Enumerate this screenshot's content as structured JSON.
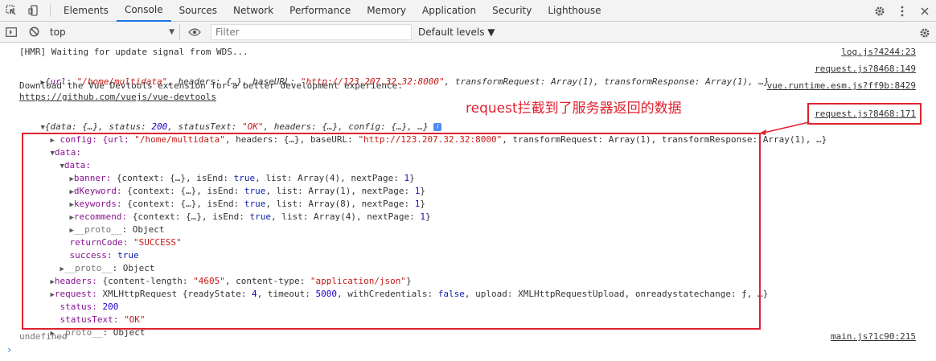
{
  "tabs": [
    "Elements",
    "Console",
    "Sources",
    "Network",
    "Performance",
    "Memory",
    "Application",
    "Security",
    "Lighthouse"
  ],
  "active_tab": "Console",
  "toolbar": {
    "context": "top",
    "filter_placeholder": "Filter",
    "levels": "Default levels ▼"
  },
  "messages": {
    "hmr": "[HMR] Waiting for update signal from WDS...",
    "hmr_src": "log.js?4244:23",
    "req1_key_url": "url",
    "req1_val_url": "\"/home/multidata\"",
    "req1_rest1": ", headers: {…}, baseURL: ",
    "req1_val_base": "\"http://123.207.32.32:8000\"",
    "req1_rest2": ", transformRequest: Array(1), transformResponse: Array(1), …}",
    "req1_src": "request.js?8468:149",
    "devtools_line1": "Download the Vue Devtools extension for a better development experience:",
    "devtools_link": "https://github.com/vuejs/vue-devtools",
    "devtools_src": "vue.runtime.esm.js?ff9b:8429",
    "resp_summary_pre": "{data: {…}, status: ",
    "resp_status": "200",
    "resp_summary_mid": ", statusText: ",
    "resp_statustext": "\"OK\"",
    "resp_summary_post": ", headers: {…}, config: {…}, …}",
    "resp_src": "request.js?8468:171",
    "config_line_pre": "config: {url: ",
    "config_url": "\"/home/multidata\"",
    "config_mid": ", headers: {…}, baseURL: ",
    "config_base": "\"http://123.207.32.32:8000\"",
    "config_post": ", transformRequest: Array(1), transformResponse: Array(1), …}",
    "data_key": "data:",
    "data_inner_key": "data:",
    "banner": "banner: ",
    "banner_val_pre": "{context: {…}, isEnd: ",
    "banner_true": "true",
    "banner_val_mid": ", list: Array(4), nextPage: ",
    "banner_num": "1",
    "banner_close": "}",
    "dkeyword": "dKeyword: ",
    "dkeyword_val_pre": "{context: {…}, isEnd: ",
    "dkeyword_true": "true",
    "dkeyword_val_mid": ", list: Array(1), nextPage: ",
    "dkeyword_num": "1",
    "dkeyword_close": "}",
    "keywords": "keywords: ",
    "keywords_val_pre": "{context: {…}, isEnd: ",
    "keywords_true": "true",
    "keywords_val_mid": ", list: Array(8), nextPage: ",
    "keywords_num": "1",
    "keywords_close": "}",
    "recommend": "recommend: ",
    "recommend_val_pre": "{context: {…}, isEnd: ",
    "recommend_true": "true",
    "recommend_val_mid": ", list: Array(4), nextPage: ",
    "recommend_num": "1",
    "recommend_close": "}",
    "proto1": "__proto__",
    "proto1_val": ": Object",
    "return_code_key": "returnCode: ",
    "return_code_val": "\"SUCCESS\"",
    "success_key": "success: ",
    "success_val": "true",
    "proto2": "__proto__",
    "proto2_val": ": Object",
    "headers_key": "headers: ",
    "headers_pre": "{content-length: ",
    "headers_len": "\"4605\"",
    "headers_mid": ", content-type: ",
    "headers_type": "\"application/json\"",
    "headers_close": "}",
    "request_key": "request: ",
    "request_pre": "XMLHttpRequest {readyState: ",
    "request_rs": "4",
    "request_mid1": ", timeout: ",
    "request_to": "5000",
    "request_mid2": ", withCredentials: ",
    "request_wc": "false",
    "request_post": ", upload: XMLHttpRequestUpload, onreadystatechange: ƒ, …}",
    "status_key": "status: ",
    "status_val": "200",
    "statustext_key": "statusText: ",
    "statustext_val": "\"OK\"",
    "proto3": "__proto__",
    "proto3_val": ": Object",
    "undefined": "undefined",
    "main_src": "main.js?1c90:215"
  },
  "annotation": "request拦截到了服务器返回的数据",
  "colors": {
    "annotation": "#e0212f",
    "accent": "#1a73e8"
  }
}
